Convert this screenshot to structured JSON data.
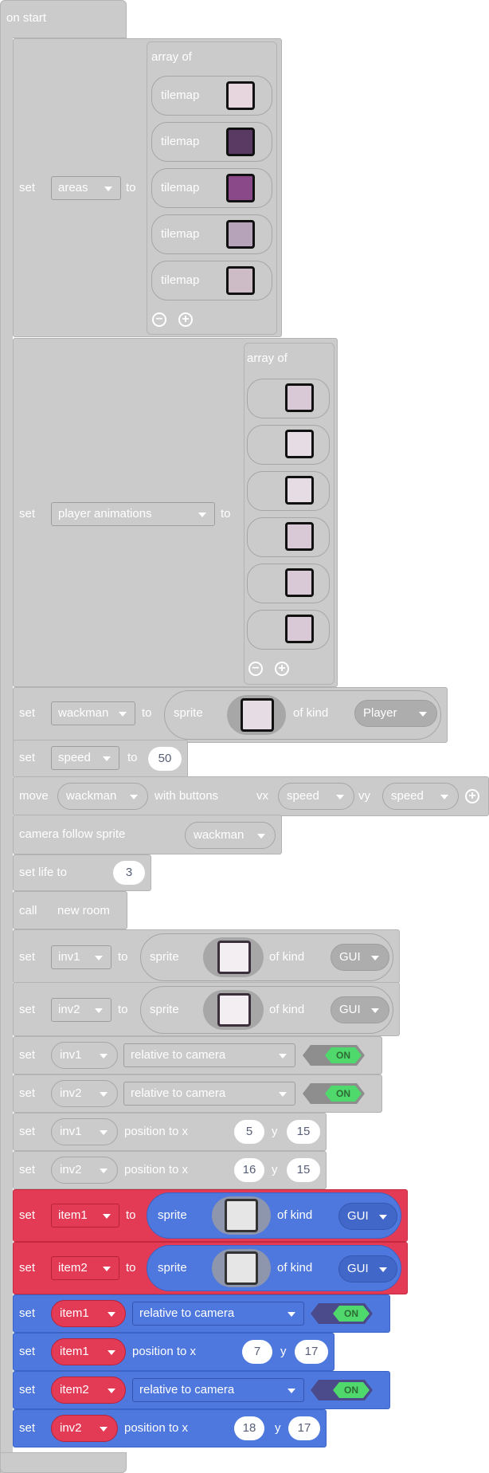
{
  "hat": {
    "label": "on start"
  },
  "kw": {
    "set": "set",
    "to": "to",
    "array_of": "array of",
    "tilemap": "tilemap",
    "sprite": "sprite",
    "of_kind": "of kind",
    "move": "move",
    "with_buttons": "with buttons",
    "vx": "vx",
    "vy": "vy",
    "camera_follow": "camera follow sprite",
    "set_life": "set life to",
    "call": "call",
    "position_to_x": "position to x",
    "y": "y"
  },
  "blocks": {
    "areas": {
      "var": "areas",
      "items": [
        "tilemap",
        "tilemap",
        "tilemap",
        "tilemap",
        "tilemap"
      ]
    },
    "player_anim": {
      "var": "player animations",
      "count": 6
    },
    "wackman": {
      "var": "wackman",
      "kind": "Player"
    },
    "speed": {
      "var": "speed",
      "value": "50"
    },
    "move": {
      "sprite": "wackman",
      "vx": "speed",
      "vy": "speed"
    },
    "camera": {
      "sprite": "wackman"
    },
    "life": {
      "value": "3"
    },
    "call": {
      "fn": "new room"
    },
    "inv1": {
      "var": "inv1",
      "kind": "GUI"
    },
    "inv2": {
      "var": "inv2",
      "kind": "GUI"
    },
    "inv1_rel": {
      "var": "inv1",
      "prop": "relative to camera",
      "toggle": "ON"
    },
    "inv2_rel": {
      "var": "inv2",
      "prop": "relative to camera",
      "toggle": "ON"
    },
    "inv1_pos": {
      "var": "inv1",
      "x": "5",
      "y": "15"
    },
    "inv2_pos": {
      "var": "inv2",
      "x": "16",
      "y": "15"
    },
    "item1": {
      "var": "item1",
      "kind": "GUI"
    },
    "item2": {
      "var": "item2",
      "kind": "GUI"
    },
    "item1_rel": {
      "var": "item1",
      "prop": "relative to camera",
      "toggle": "ON"
    },
    "item1_pos": {
      "var": "item1",
      "x": "7",
      "y": "17"
    },
    "item2_rel": {
      "var": "item2",
      "prop": "relative to camera",
      "toggle": "ON"
    },
    "inv2_pos2": {
      "var": "inv2",
      "x": "18",
      "y": "17"
    }
  },
  "colors": {
    "sprites": "#e33a55",
    "blocks_blue": "#4e78dd",
    "toggle_on": "#4fd86b"
  }
}
